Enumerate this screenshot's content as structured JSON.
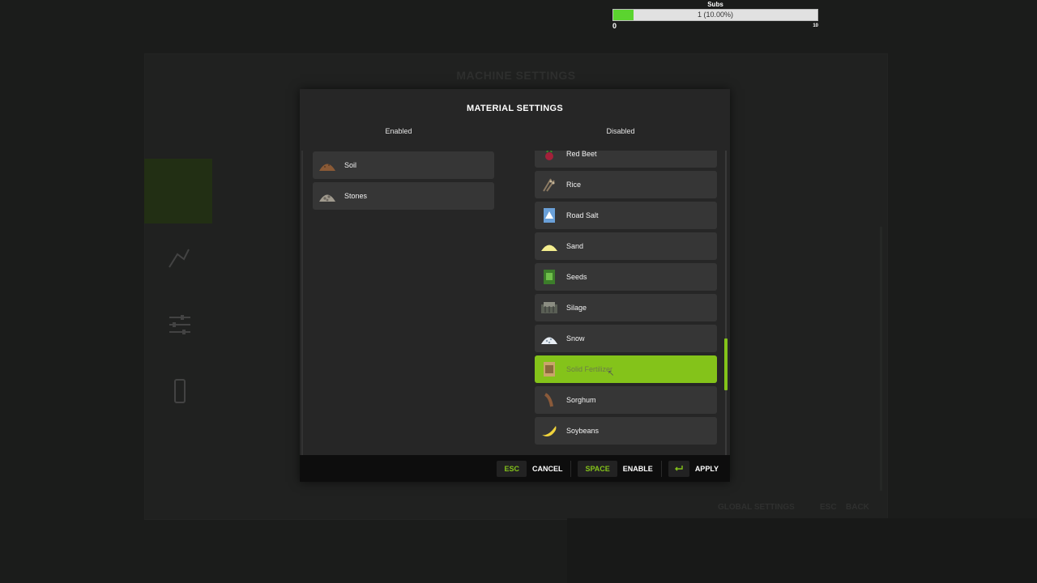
{
  "background": {
    "title": "MACHINE SETTINGS",
    "footer_global": "GLOBAL SETTINGS",
    "footer_back": "BACK",
    "footer_esc": "ESC"
  },
  "subs": {
    "title": "Subs",
    "value_text": "1 (10.00%)",
    "progress": 0.1,
    "min": "0",
    "max": "10",
    "fill_color": "#5bd42f"
  },
  "dialog": {
    "title": "MATERIAL SETTINGS",
    "enabled_header": "Enabled",
    "disabled_header": "Disabled",
    "enabled_items": [
      {
        "label": "Soil",
        "icon": "soil-pile-icon"
      },
      {
        "label": "Stones",
        "icon": "stones-pile-icon"
      }
    ],
    "disabled_items": [
      {
        "label": "Red Beet",
        "icon": "red-beet-icon"
      },
      {
        "label": "Rice",
        "icon": "rice-icon"
      },
      {
        "label": "Road Salt",
        "icon": "road-salt-icon"
      },
      {
        "label": "Sand",
        "icon": "sand-pile-icon"
      },
      {
        "label": "Seeds",
        "icon": "seeds-bag-icon"
      },
      {
        "label": "Silage",
        "icon": "silage-icon"
      },
      {
        "label": "Snow",
        "icon": "snow-pile-icon"
      },
      {
        "label": "Solid Fertilizer",
        "icon": "fertilizer-bag-icon",
        "selected": true
      },
      {
        "label": "Sorghum",
        "icon": "sorghum-icon"
      },
      {
        "label": "Soybeans",
        "icon": "soybeans-icon"
      }
    ],
    "accent_color": "#84c31a"
  },
  "footer": {
    "cancel_key": "ESC",
    "cancel_label": "CANCEL",
    "enable_key": "SPACE",
    "enable_label": "ENABLE",
    "apply_key_icon": "enter-key-icon",
    "apply_label": "APPLY"
  }
}
